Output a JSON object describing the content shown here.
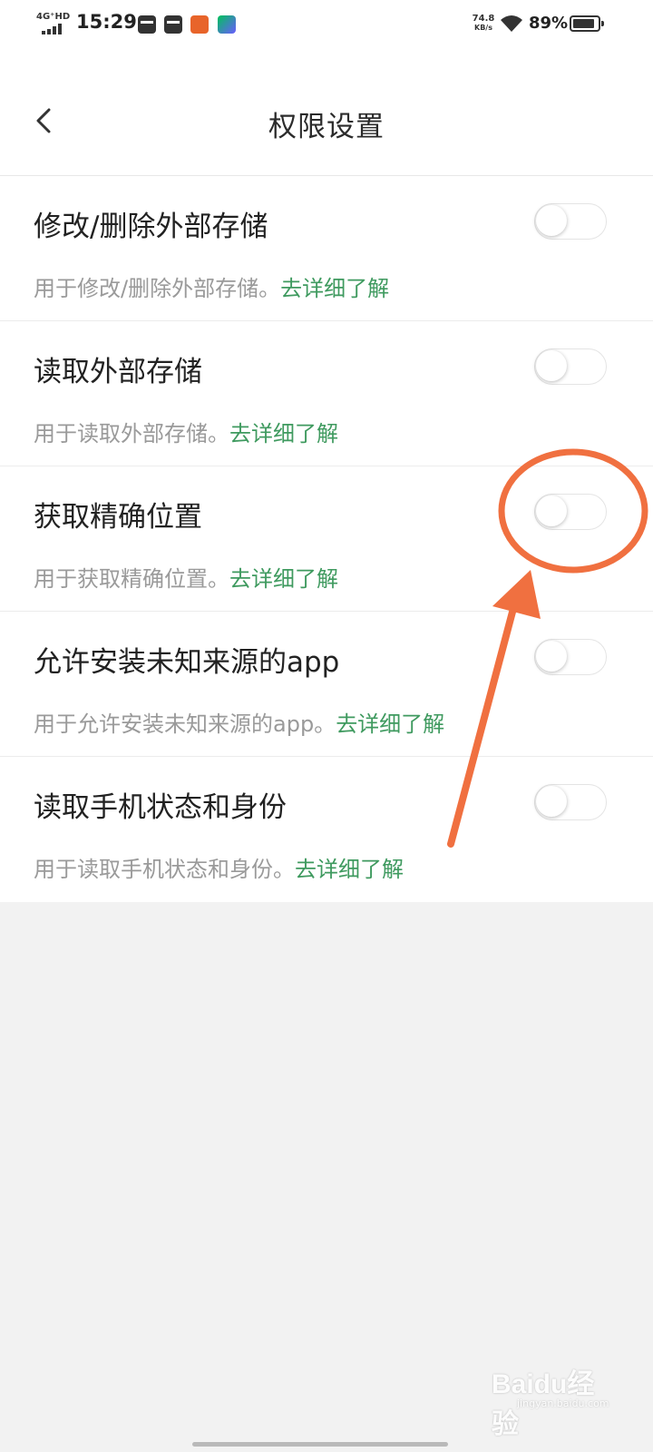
{
  "status_bar": {
    "network": "4G⁺HD",
    "time": "15:29",
    "speed_value": "74.8",
    "speed_unit": "KB/s",
    "battery_pct": "89%",
    "battery_level": 0.89,
    "app_icons": [
      "sim-card-icon",
      "sim-card-icon",
      "orange-app-icon",
      "iqiyi-app-icon"
    ]
  },
  "header": {
    "back_icon": "chevron-left-icon",
    "title": "权限设置"
  },
  "permissions": [
    {
      "title": "修改/删除外部存储",
      "desc": "用于修改/删除外部存储。",
      "link": "去详细了解",
      "enabled": false
    },
    {
      "title": "读取外部存储",
      "desc": "用于读取外部存储。",
      "link": "去详细了解",
      "enabled": false
    },
    {
      "title": "获取精确位置",
      "desc": "用于获取精确位置。",
      "link": "去详细了解",
      "enabled": false
    },
    {
      "title": "允许安装未知来源的app",
      "desc": "用于允许安装未知来源的app。",
      "link": "去详细了解",
      "enabled": false
    },
    {
      "title": "读取手机状态和身份",
      "desc": "用于读取手机状态和身份。",
      "link": "去详细了解",
      "enabled": false
    }
  ],
  "colors": {
    "link": "#3f9a5f",
    "annotation": "#f07040",
    "background": "#f2f2f2"
  },
  "watermark": {
    "main": "Baidu经验",
    "sub": "jingyan.baidu.com"
  }
}
